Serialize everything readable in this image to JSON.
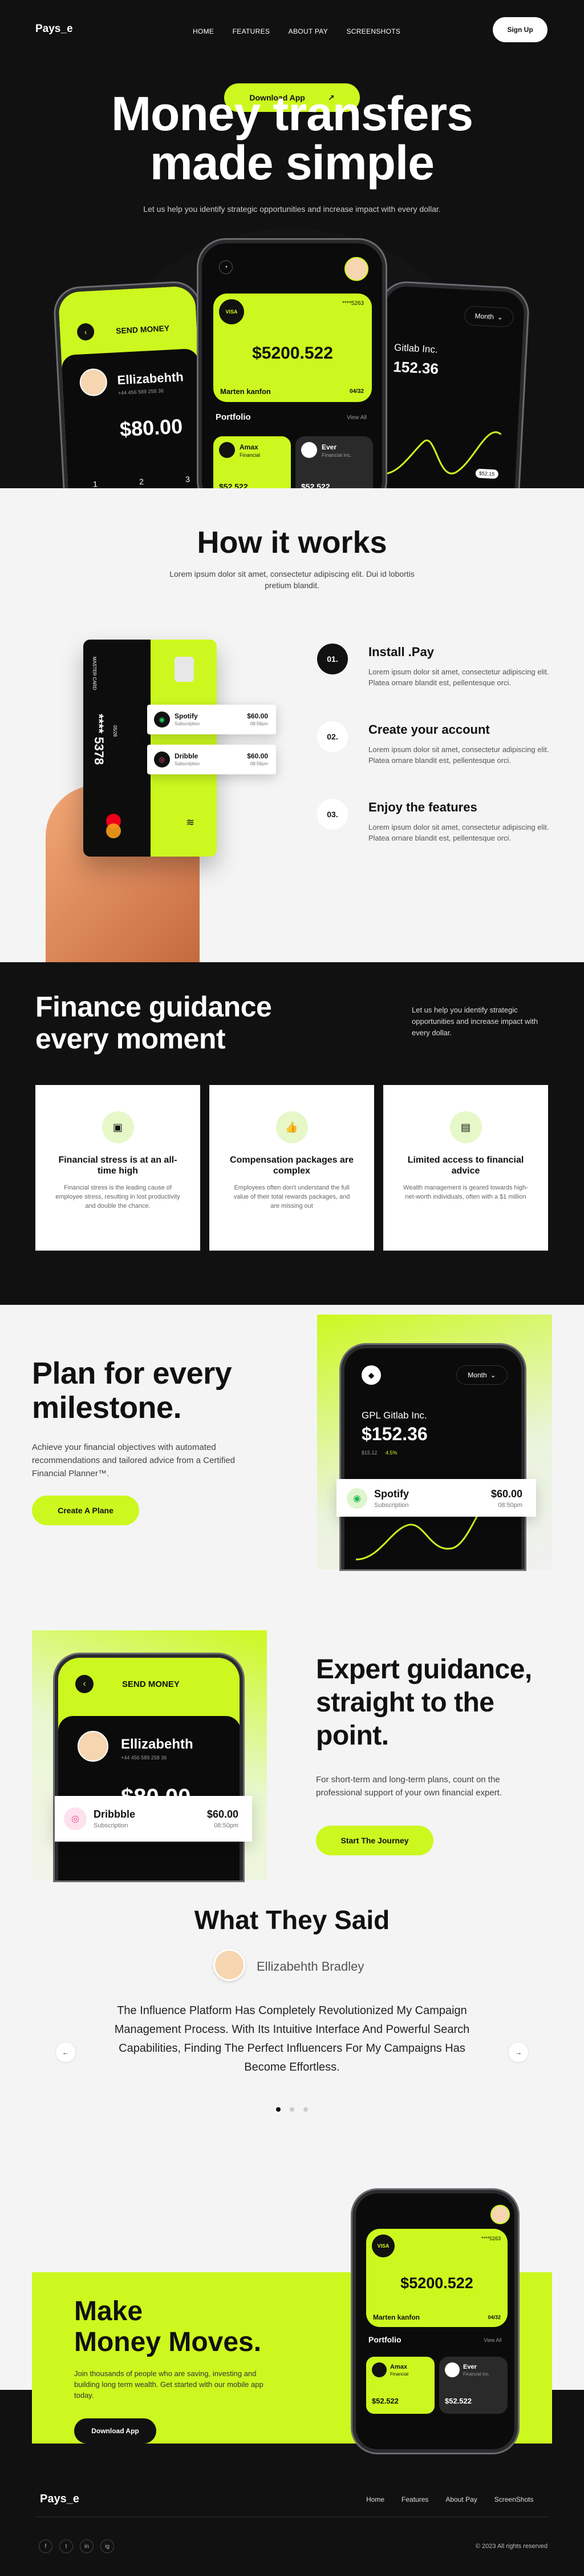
{
  "brand": "Pays_e",
  "nav": [
    "HOME",
    "FEATURES",
    "ABOUT PAY",
    "SCREENSHOTS"
  ],
  "signup": "Sign Up",
  "hero": {
    "download": "Download App",
    "title1": "Money transfers",
    "title2": "made simple",
    "subtitle": "Let us help you identify strategic opportunities and increase impact with every dollar.",
    "left_phone": {
      "header": "SEND MONEY",
      "name": "Ellizabehth",
      "phone": "+44 456 589 258 36",
      "amount": "$80.00",
      "keys": [
        "1",
        "2",
        "3"
      ]
    },
    "center_phone": {
      "card_label": "VISA",
      "card_no": "****5263",
      "amount": "$5200.522",
      "holder": "Marten kanfon",
      "exp": "04/32",
      "portfolio": "Portfolio",
      "view_all": "View All",
      "tile1": {
        "name": "Amax",
        "sub": "Financial",
        "value": "$52.522"
      },
      "tile2": {
        "name": "Ever",
        "sub": "Financial inc.",
        "value": "$52.522"
      }
    },
    "right_phone": {
      "month": "Month",
      "company": "Gitlab Inc.",
      "amount": "152.36",
      "tag": "$52.15"
    }
  },
  "how": {
    "title": "How it works",
    "subtitle": "Lorem ipsum dolor sit amet, consectetur adipiscing elit. Dui id lobortis pretium blandit.",
    "card_no": "**** 5378",
    "card_side": "MASTER CARD",
    "card_exp": "05/28",
    "tx": [
      {
        "name": "Spotify",
        "sub": "Subscription",
        "value": "$60.00",
        "time": "08:56pm"
      },
      {
        "name": "Dribble",
        "sub": "Subscription",
        "value": "$60.00",
        "time": "08:56pm"
      }
    ],
    "steps": [
      {
        "n": "01.",
        "title": "Install .Pay",
        "desc": "Lorem ipsum dolor sit amet, consectetur adipiscing elit. Platea ornare blandit est, pellentesque orci."
      },
      {
        "n": "02.",
        "title": "Create your account",
        "desc": "Lorem ipsum dolor sit amet, consectetur adipiscing elit. Platea ornare blandit est, pellentesque orci."
      },
      {
        "n": "03.",
        "title": "Enjoy the features",
        "desc": "Lorem ipsum dolor sit amet, consectetur adipiscing elit. Platea ornare blandit est, pellentesque orci."
      }
    ]
  },
  "finance": {
    "title1": "Finance guidance",
    "title2": "every moment",
    "desc": "Let us help you identify strategic opportunities and increase impact with every dollar.",
    "cards": [
      {
        "title": "Financial stress is at an all-time high",
        "desc": "Financial stress is the leading cause of employee stress, resulting in lost productivity and double the chance."
      },
      {
        "title": "Compensation packages are complex",
        "desc": "Employees often don't understand the full value of their total rewards packages, and are missing out"
      },
      {
        "title": "Limited access to financial advice",
        "desc": "Wealth management is geared towards high-net-worth individuals, often with a $1 million"
      }
    ]
  },
  "plan": {
    "title1": "Plan for every",
    "title2": "milestone.",
    "desc": "Achieve your financial objectives with automated recommendations and tailored advice from a Certified Financial Planner™.",
    "button": "Create A Plane",
    "phone": {
      "month": "Month",
      "company": "GPL Gitlab Inc.",
      "amount": "$152.36",
      "sub": "$15.12",
      "pct": "4.5%"
    },
    "tx": {
      "name": "Spotify",
      "sub": "Subscription",
      "value": "$60.00",
      "time": "08:50pm"
    }
  },
  "expert": {
    "title1": "Expert guidance,",
    "title2": "straight to the",
    "title3": "point.",
    "desc": "For short-term and long-term plans, count on the professional support of your own financial expert.",
    "button": "Start The Journey",
    "phone": {
      "header": "SEND MONEY",
      "name": "Ellizabehth",
      "phone": "+44 456 589 258 36",
      "amount": "$80.00"
    },
    "tx": {
      "name": "Dribbble",
      "sub": "Subscription",
      "value": "$60.00",
      "time": "08:50pm"
    }
  },
  "testimonial": {
    "title": "What They Said",
    "name": "Ellizabehth Bradley",
    "quote": "The Influence Platform Has Completely Revolutionized My Campaign Management Process. With Its Intuitive Interface And Powerful Search Capabilities, Finding The Perfect Influencers For My Campaigns Has Become Effortless."
  },
  "cta": {
    "title1": "Make",
    "title2": "Money Moves.",
    "desc": "Join thousands of people who are saving, investing and building long term wealth. Get started with our mobile app today.",
    "button": "Download App",
    "phone": {
      "card_label": "VISA",
      "card_no": "****5263",
      "amount": "$5200.522",
      "holder": "Marten kanfon",
      "exp": "04/32",
      "portfolio": "Portfolio",
      "view_all": "View All",
      "tile1": {
        "name": "Amax",
        "sub": "Financial",
        "value": "$52.522"
      },
      "tile2": {
        "name": "Ever",
        "sub": "Financial inc.",
        "value": "$52.522"
      }
    }
  },
  "footer": {
    "links": [
      "Home",
      "Features",
      "About Pay",
      "ScreenShots"
    ],
    "social": [
      "f",
      "t",
      "in",
      "ig"
    ],
    "copy": "© 2023 All rights reserved"
  }
}
